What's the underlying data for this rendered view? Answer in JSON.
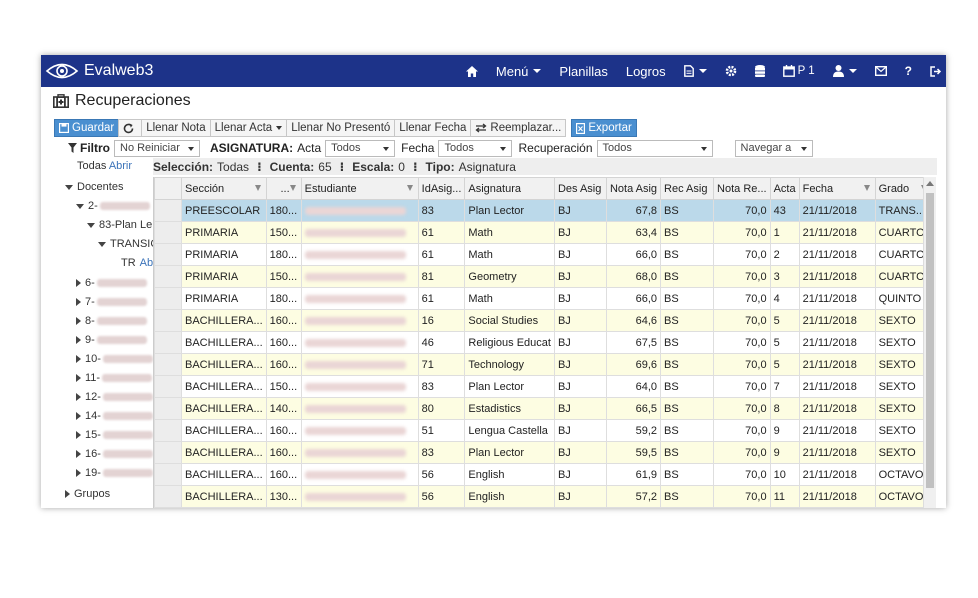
{
  "app": {
    "title": "Evalweb3"
  },
  "nav": {
    "menu": "Menú",
    "planillas": "Planillas",
    "logros": "Logros",
    "period": "P 1"
  },
  "page": {
    "title": "Recuperaciones"
  },
  "toolbar": {
    "guardar": "Guardar",
    "llenar_nota": "Llenar Nota",
    "llenar_acta": "Llenar Acta",
    "llenar_no_presento": "Llenar No Presentó",
    "llenar_fecha": "Llenar Fecha",
    "reemplazar": "Reemplazar...",
    "exportar": "Exportar"
  },
  "filters": {
    "filtro_label": "Filtro",
    "filtro_value": "No Reiniciar",
    "asignatura_label": "ASIGNATURA:",
    "acta_label": "Acta",
    "acta_value": "Todos",
    "fecha_label": "Fecha",
    "fecha_value": "Todos",
    "recuperacion_label": "Recuperación",
    "recuperacion_value": "Todos",
    "navegar": "Navegar a"
  },
  "summary": {
    "seleccion_label": "Selección:",
    "seleccion_value": "Todas",
    "cuenta_label": "Cuenta:",
    "cuenta_value": "65",
    "escala_label": "Escala:",
    "escala_value": "0",
    "tipo_label": "Tipo:",
    "tipo_value": "Asignatura"
  },
  "tree": {
    "todas": "Todas",
    "abrir": "Abrir",
    "docentes": "Docentes",
    "n2": "2-",
    "n83": "83-Plan Le",
    "transic": "TRANSIC",
    "tr": "TR",
    "tr_abr": "Abr",
    "items": [
      "6-",
      "7-",
      "8-",
      "9-",
      "10-",
      "11-",
      "12-",
      "14-",
      "15-",
      "16-",
      "19-"
    ],
    "grupos": "Grupos"
  },
  "grid": {
    "columns": [
      "Sección",
      "...",
      "Estudiante",
      "IdAsig...",
      "Asignatura",
      "Des Asig",
      "Nota Asig",
      "Rec Asig",
      "Nota Re...",
      "Acta",
      "Fecha",
      "Grado"
    ],
    "rows": [
      {
        "seccion": "PREESCOLAR",
        "id": "180...",
        "idasig": "83",
        "asignatura": "Plan Lector",
        "des": "BJ",
        "nota": "67,8",
        "rec": "BS",
        "notare": "70,0",
        "acta": "43",
        "fecha": "21/11/2018",
        "grado": "TRANS..."
      },
      {
        "seccion": "PRIMARIA",
        "id": "150...",
        "idasig": "61",
        "asignatura": "Math",
        "des": "BJ",
        "nota": "63,4",
        "rec": "BS",
        "notare": "70,0",
        "acta": "1",
        "fecha": "21/11/2018",
        "grado": "CUARTO"
      },
      {
        "seccion": "PRIMARIA",
        "id": "180...",
        "idasig": "61",
        "asignatura": "Math",
        "des": "BJ",
        "nota": "66,0",
        "rec": "BS",
        "notare": "70,0",
        "acta": "2",
        "fecha": "21/11/2018",
        "grado": "CUARTO"
      },
      {
        "seccion": "PRIMARIA",
        "id": "150...",
        "idasig": "81",
        "asignatura": "Geometry",
        "des": "BJ",
        "nota": "68,0",
        "rec": "BS",
        "notare": "70,0",
        "acta": "3",
        "fecha": "21/11/2018",
        "grado": "CUARTO"
      },
      {
        "seccion": "PRIMARIA",
        "id": "180...",
        "idasig": "61",
        "asignatura": "Math",
        "des": "BJ",
        "nota": "66,0",
        "rec": "BS",
        "notare": "70,0",
        "acta": "4",
        "fecha": "21/11/2018",
        "grado": "QUINTO"
      },
      {
        "seccion": "BACHILLERA...",
        "id": "160...",
        "idasig": "16",
        "asignatura": "Social Studies",
        "des": "BJ",
        "nota": "64,6",
        "rec": "BS",
        "notare": "70,0",
        "acta": "5",
        "fecha": "21/11/2018",
        "grado": "SEXTO"
      },
      {
        "seccion": "BACHILLERA...",
        "id": "160...",
        "idasig": "46",
        "asignatura": "Religious Educat",
        "des": "BJ",
        "nota": "67,5",
        "rec": "BS",
        "notare": "70,0",
        "acta": "5",
        "fecha": "21/11/2018",
        "grado": "SEXTO"
      },
      {
        "seccion": "BACHILLERA...",
        "id": "160...",
        "idasig": "71",
        "asignatura": "Technology",
        "des": "BJ",
        "nota": "69,6",
        "rec": "BS",
        "notare": "70,0",
        "acta": "5",
        "fecha": "21/11/2018",
        "grado": "SEXTO"
      },
      {
        "seccion": "BACHILLERA...",
        "id": "150...",
        "idasig": "83",
        "asignatura": "Plan Lector",
        "des": "BJ",
        "nota": "64,0",
        "rec": "BS",
        "notare": "70,0",
        "acta": "7",
        "fecha": "21/11/2018",
        "grado": "SEXTO"
      },
      {
        "seccion": "BACHILLERA...",
        "id": "140...",
        "idasig": "80",
        "asignatura": "Estadistics",
        "des": "BJ",
        "nota": "66,5",
        "rec": "BS",
        "notare": "70,0",
        "acta": "8",
        "fecha": "21/11/2018",
        "grado": "SEXTO"
      },
      {
        "seccion": "BACHILLERA...",
        "id": "160...",
        "idasig": "51",
        "asignatura": "Lengua Castella",
        "des": "BJ",
        "nota": "59,2",
        "rec": "BS",
        "notare": "70,0",
        "acta": "9",
        "fecha": "21/11/2018",
        "grado": "SEXTO"
      },
      {
        "seccion": "BACHILLERA...",
        "id": "160...",
        "idasig": "83",
        "asignatura": "Plan Lector",
        "des": "BJ",
        "nota": "59,5",
        "rec": "BS",
        "notare": "70,0",
        "acta": "9",
        "fecha": "21/11/2018",
        "grado": "SEXTO"
      },
      {
        "seccion": "BACHILLERA...",
        "id": "160...",
        "idasig": "56",
        "asignatura": "English",
        "des": "BJ",
        "nota": "61,9",
        "rec": "BS",
        "notare": "70,0",
        "acta": "10",
        "fecha": "21/11/2018",
        "grado": "OCTAVO"
      },
      {
        "seccion": "BACHILLERA...",
        "id": "130...",
        "idasig": "56",
        "asignatura": "English",
        "des": "BJ",
        "nota": "57,2",
        "rec": "BS",
        "notare": "70,0",
        "acta": "11",
        "fecha": "21/11/2018",
        "grado": "OCTAVO"
      }
    ]
  },
  "colors": {
    "navbar": "#1d3389",
    "primary_button": "#4a8fd0",
    "selected_row": "#bbd9ea",
    "odd_row": "#fdfde2"
  }
}
